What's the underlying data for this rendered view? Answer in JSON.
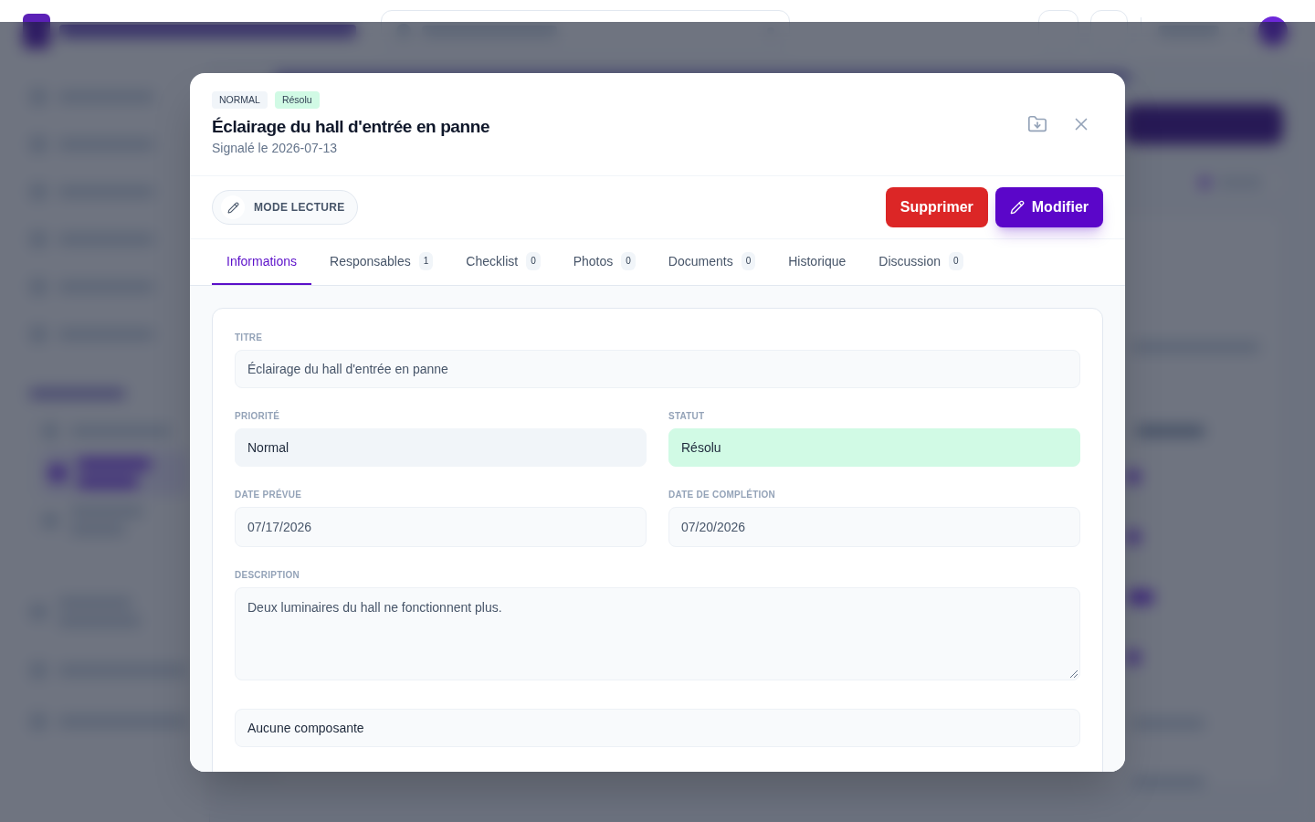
{
  "modal": {
    "badges": [
      {
        "text": "NORMAL",
        "color": "#f1f5f9"
      },
      {
        "text": "Résolu",
        "color": "#d1fae5"
      }
    ],
    "title": "Éclairage du hall d'entrée en panne",
    "subtitle": "Signalé le 2026-07-13"
  },
  "toolbar": {
    "mode_button": "MODE LECTURE",
    "delete_button": "Supprimer",
    "edit_button": "Modifier"
  },
  "tabs": [
    {
      "label": "Informations",
      "selected": true
    },
    {
      "label": "Responsables",
      "count": "1",
      "selected": false
    },
    {
      "label": "Checklist",
      "count": "0",
      "selected": false
    },
    {
      "label": "Photos",
      "count": "0",
      "selected": false
    },
    {
      "label": "Documents",
      "count": "0",
      "selected": false
    },
    {
      "label": "Historique",
      "selected": false
    },
    {
      "label": "Discussion",
      "count": "0",
      "selected": false
    }
  ],
  "form": {
    "title": {
      "label": "TITRE",
      "value": "Éclairage du hall d'entrée en panne"
    },
    "priority": {
      "label": "PRIORITÉ",
      "value": "Normal",
      "color": "#f1f5f9"
    },
    "status": {
      "label": "STATUT",
      "value": "Résolu",
      "color": "#d1fae5"
    },
    "planned_date": {
      "label": "DATE PRÉVUE",
      "value": "07/17/2026"
    },
    "completion_date": {
      "label": "DATE DE COMPLÉTION",
      "value": "07/20/2026"
    },
    "description": {
      "label": "DESCRIPTION",
      "value": "Deux luminaires du hall ne fonctionnent plus."
    },
    "component": {
      "value": "Aucune composante"
    }
  }
}
